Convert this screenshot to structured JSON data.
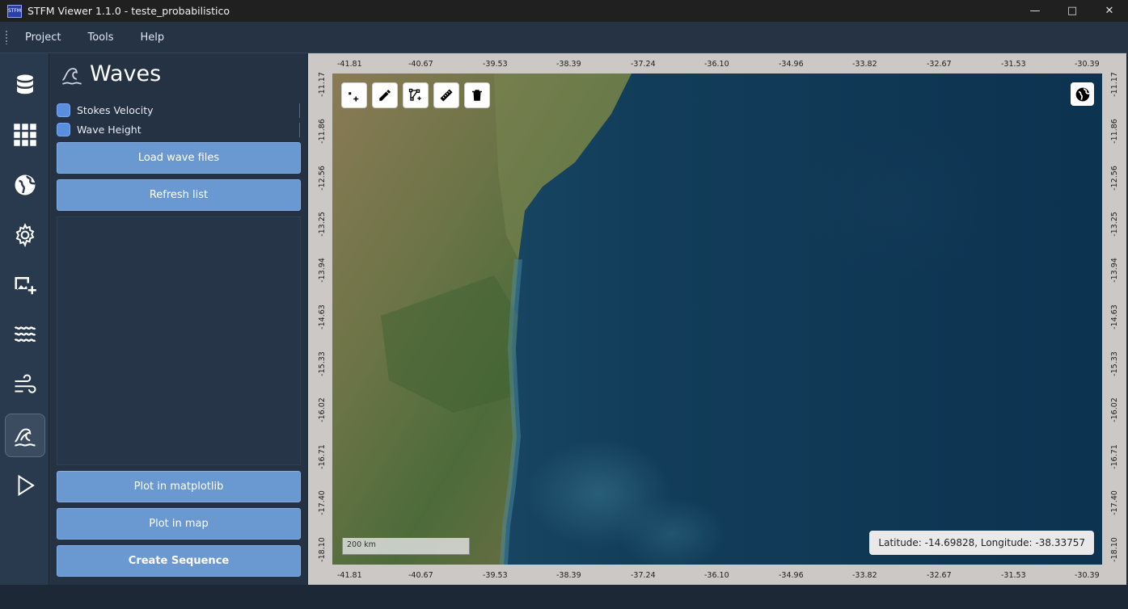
{
  "window": {
    "title": "STFM Viewer 1.1.0 - teste_probabilistico",
    "app_icon_label": "STFM"
  },
  "menu": [
    "Project",
    "Tools",
    "Help"
  ],
  "sidebar_icons": [
    "database-icon",
    "grid-icon",
    "globe-icon",
    "gear-icon",
    "add-image-icon",
    "water-icon",
    "wind-icon",
    "wave-icon",
    "play-icon"
  ],
  "panel": {
    "title": "Waves",
    "checks": [
      {
        "label": "Stokes Velocity",
        "checked": true
      },
      {
        "label": "Wave Height",
        "checked": true
      }
    ],
    "buttons": {
      "load": "Load wave files",
      "refresh": "Refresh list",
      "plot_matplotlib": "Plot in matplotlib",
      "plot_map": "Plot in map",
      "create_sequence": "Create Sequence"
    }
  },
  "map": {
    "lon_ticks": [
      "-41.81",
      "-40.67",
      "-39.53",
      "-38.39",
      "-37.24",
      "-36.10",
      "-34.96",
      "-33.82",
      "-32.67",
      "-31.53",
      "-30.39"
    ],
    "lat_ticks": [
      "-11.17",
      "-11.86",
      "-12.56",
      "-13.25",
      "-13.94",
      "-14.63",
      "-15.33",
      "-16.02",
      "-16.71",
      "-17.40",
      "-18.10"
    ],
    "scale_label": "200 km",
    "coordinates": "Latitude: -14.69828, Longitude: -38.33757",
    "tools": [
      "add-point-icon",
      "pencil-icon",
      "polyline-icon",
      "ruler-icon",
      "trash-icon"
    ]
  }
}
